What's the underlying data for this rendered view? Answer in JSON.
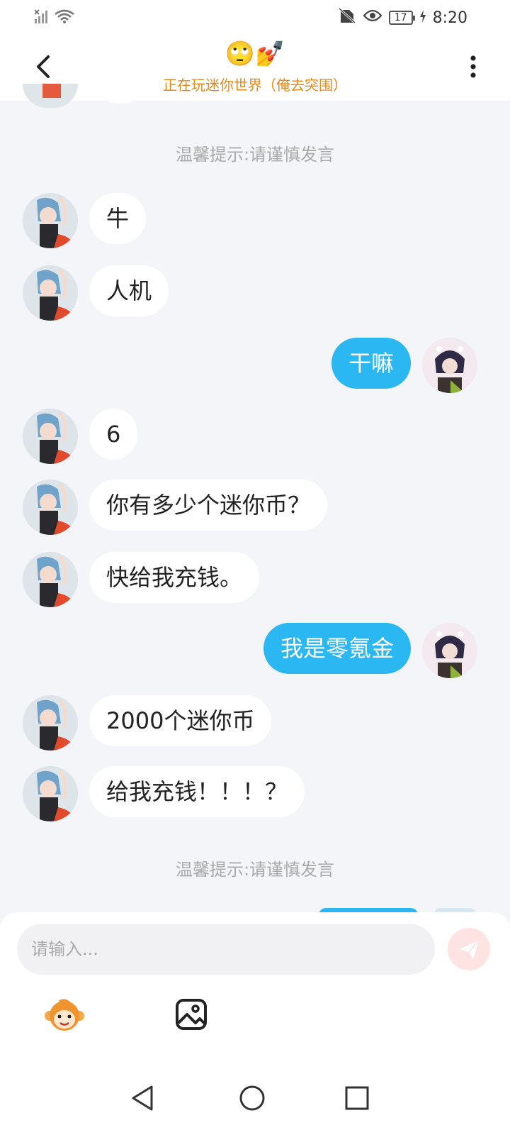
{
  "status_bar": {
    "time": "8:20",
    "battery": "17"
  },
  "header": {
    "title_emoji": "🙄💅",
    "subtitle": "正在玩迷你世界（俺去突围）"
  },
  "notices": [
    "温馨提示:请谨慎发言",
    "温馨提示:请谨慎发言"
  ],
  "messages": [
    {
      "side": "in",
      "text": "牛"
    },
    {
      "side": "in",
      "text": "人机"
    },
    {
      "side": "out",
      "text": "干嘛"
    },
    {
      "side": "in",
      "text": "6"
    },
    {
      "side": "in",
      "text": "你有多少个迷你币？"
    },
    {
      "side": "in",
      "text": "快给我充钱。"
    },
    {
      "side": "out",
      "text": "我是零氪金"
    },
    {
      "side": "in",
      "text": "2000个迷你币"
    },
    {
      "side": "in",
      "text": "给我充钱！！！？"
    }
  ],
  "input": {
    "placeholder": "请输入..."
  },
  "icons": {
    "back": "chevron-left-icon",
    "more": "more-vertical-icon",
    "send": "send-icon",
    "emoji_panel": "monkey-emoji-icon",
    "image": "image-icon",
    "nav_back": "triangle-back-icon",
    "nav_home": "circle-home-icon",
    "nav_recent": "square-recent-icon"
  },
  "colors": {
    "accent": "#2ab7f2",
    "subtitle": "#e38a1c",
    "background": "#f4f5f9"
  }
}
